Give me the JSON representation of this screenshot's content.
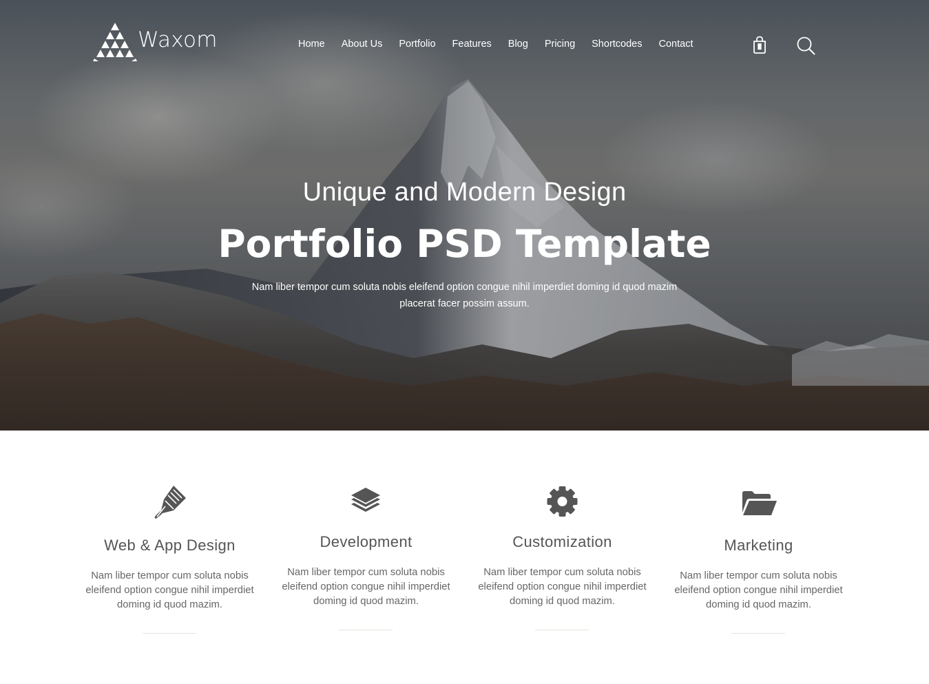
{
  "header": {
    "logo_text": "Waxom",
    "nav": [
      {
        "label": "Home"
      },
      {
        "label": "About Us"
      },
      {
        "label": "Portfolio"
      },
      {
        "label": "Features"
      },
      {
        "label": "Blog"
      },
      {
        "label": "Pricing"
      },
      {
        "label": "Shortcodes"
      },
      {
        "label": "Contact"
      }
    ],
    "icons": [
      "shopping-bag-icon",
      "search-icon"
    ]
  },
  "hero": {
    "subtitle": "Unique and Modern Design",
    "title": "Portfolio PSD Template",
    "description": "Nam liber tempor cum soluta nobis eleifend option congue nihil imperdiet doming id quod mazim placerat facer possim assum."
  },
  "features": [
    {
      "icon": "pen-nib-icon",
      "title": "Web & App Design",
      "text": "Nam liber tempor cum soluta nobis eleifend option congue nihil imperdiet doming id quod mazim."
    },
    {
      "icon": "layers-icon",
      "title": "Development",
      "text": "Nam liber tempor cum soluta nobis eleifend option congue nihil imperdiet doming id quod mazim."
    },
    {
      "icon": "gear-icon",
      "title": "Customization",
      "text": "Nam liber tempor cum soluta nobis eleifend option congue nihil imperdiet doming id quod mazim."
    },
    {
      "icon": "folder-open-icon",
      "title": "Marketing",
      "text": "Nam liber tempor cum soluta nobis eleifend option congue nihil imperdiet doming id quod mazim."
    }
  ],
  "colors": {
    "icon": "#555555",
    "heading": "#555555",
    "body_text": "#666666",
    "divider": "#e7e2da",
    "hero_text": "#ffffff"
  }
}
